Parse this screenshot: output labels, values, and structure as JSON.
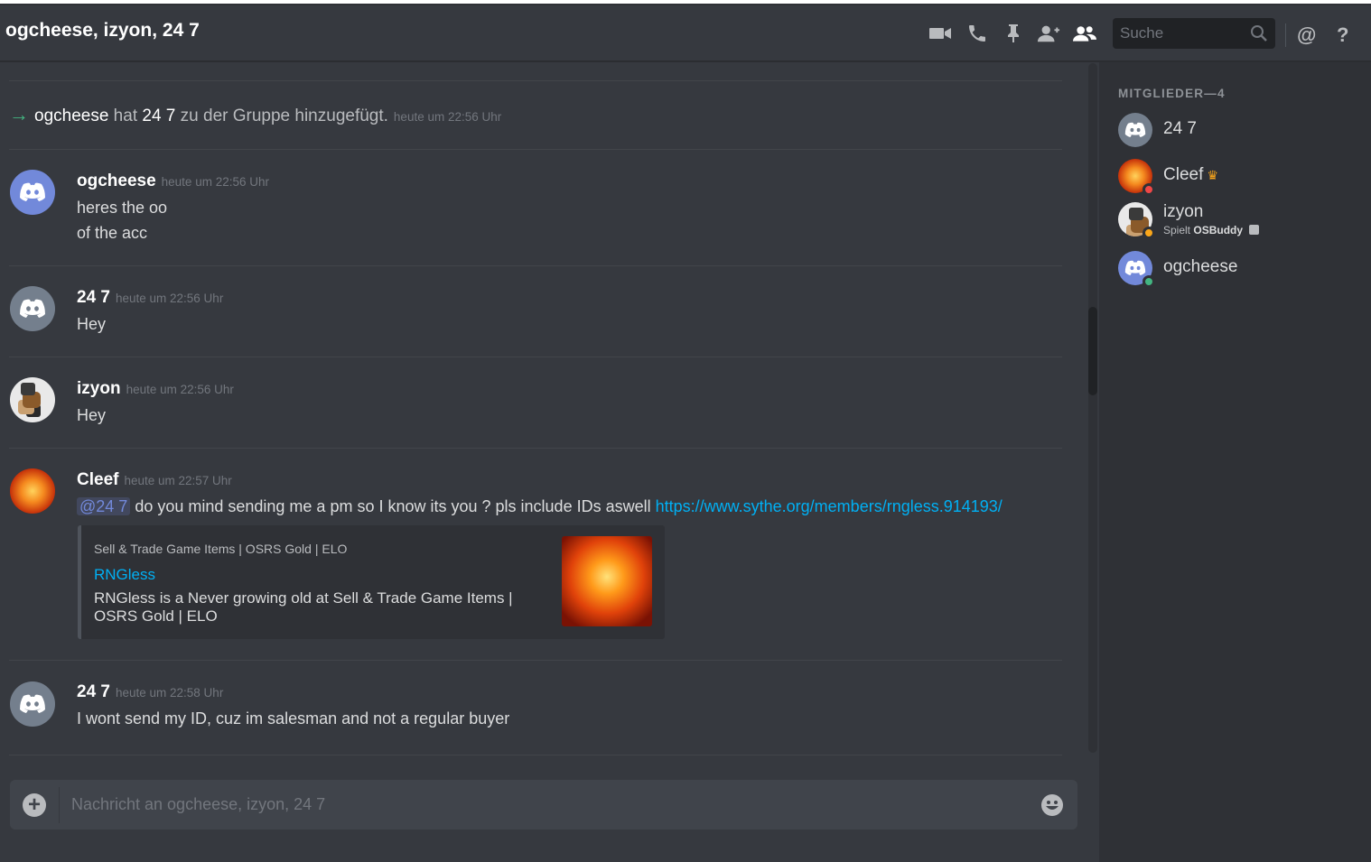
{
  "header": {
    "title": "ogcheese, izyon, 24 7",
    "search_placeholder": "Suche",
    "mentions_glyph": "@",
    "help_glyph": "?",
    "icons": [
      "video-icon",
      "phone-icon",
      "pin-icon",
      "add-friend-icon",
      "members-icon",
      "search-icon"
    ]
  },
  "system_message": {
    "actor": "ogcheese",
    "text_before": " hat ",
    "target": "24 7",
    "text_after": " zu der Gruppe hinzugefügt.",
    "timestamp": "heute um 22:56 Uhr"
  },
  "messages": [
    {
      "author": "ogcheese",
      "timestamp": "heute um 22:56 Uhr",
      "lines": [
        "heres the oo",
        "of the acc"
      ]
    },
    {
      "author": "24 7",
      "timestamp": "heute um 22:56 Uhr",
      "lines": [
        "Hey"
      ]
    },
    {
      "author": "izyon",
      "timestamp": "heute um 22:56 Uhr",
      "lines": [
        "Hey"
      ]
    },
    {
      "author": "Cleef",
      "timestamp": "heute um 22:57 Uhr",
      "mention": "@24 7",
      "text": " do you mind sending me a pm so I know its you ? pls include  IDs aswell ",
      "link": "https://www.sythe.org/members/rngless.914193/",
      "embed": {
        "provider": "Sell & Trade Game Items | OSRS Gold | ELO",
        "title": "RNGless",
        "description": "RNGless is a Never growing old at Sell & Trade Game Items | OSRS Gold | ELO"
      }
    },
    {
      "author": "24 7",
      "timestamp": "heute um 22:58 Uhr",
      "lines": [
        "I wont send my ID, cuz im salesman and not a regular buyer"
      ]
    }
  ],
  "composer": {
    "placeholder": "Nachricht an ogcheese, izyon, 24 7"
  },
  "members_panel": {
    "title": "MITGLIEDER—4",
    "members": [
      {
        "name": "24 7",
        "status": "none"
      },
      {
        "name": "Cleef",
        "owner_crown": "♛",
        "status": "dnd"
      },
      {
        "name": "izyon",
        "activity_prefix": "Spielt ",
        "activity_game": "OSBuddy",
        "status": "idle"
      },
      {
        "name": "ogcheese",
        "status": "online"
      }
    ]
  },
  "colors": {
    "blurple": "#7289da",
    "link": "#00b0f4",
    "online": "#43b581",
    "idle": "#faa61a",
    "dnd": "#f04747"
  }
}
